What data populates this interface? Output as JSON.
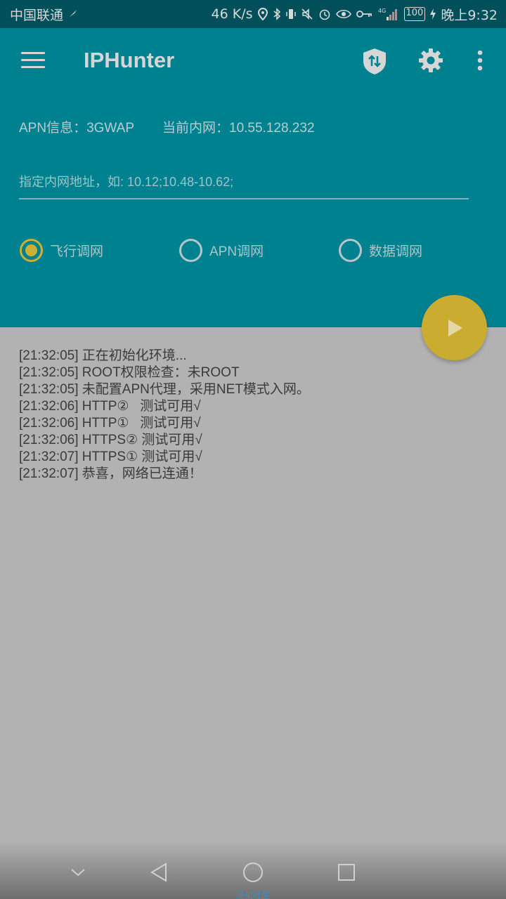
{
  "status_bar": {
    "carrier": "中国联通",
    "speed": "46 K/s",
    "network": "4G",
    "battery": "100",
    "time": "晚上9:32"
  },
  "toolbar": {
    "title": "IPHunter",
    "icons": [
      "menu-icon",
      "shield-icon",
      "gear-icon",
      "more-vert-icon"
    ]
  },
  "info": {
    "apn": "APN信息：3GWAP",
    "intranet": "当前内网：10.55.128.232"
  },
  "ip_input": {
    "value": "",
    "placeholder": "指定内网地址，如: 10.12;10.48-10.62;"
  },
  "modes": {
    "selected": "飞行调网",
    "options": [
      "飞行调网",
      "APN调网",
      "数据调网"
    ]
  },
  "fab": {
    "icon": "play-icon"
  },
  "log": [
    "[21:32:05] 正在初始化环境...",
    "[21:32:05] ROOT权限检查：未ROOT",
    "[21:32:05] 未配置APN代理，采用NET模式入网。",
    "[21:32:06] HTTP②   测试可用√",
    "[21:32:06] HTTP①   测试可用√",
    "[21:32:06] HTTPS② 测试可用√",
    "[21:32:07] HTTPS① 测试可用√",
    "[21:32:07] 恭喜，网络已连通！"
  ],
  "nav": {
    "icons": [
      "chevron-down-icon",
      "back-icon",
      "home-icon",
      "recents-icon"
    ]
  },
  "watermark": "流星社区",
  "colors": {
    "status_bar": "#014f5a",
    "header": "#00818f",
    "accent": "#c9ac30",
    "body": "#b2b2b2"
  }
}
